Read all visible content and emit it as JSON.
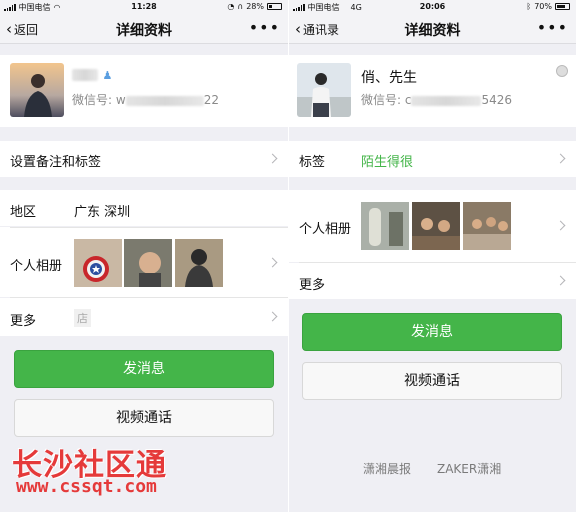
{
  "left": {
    "status": {
      "carrier": "中国电信",
      "time": "11:28",
      "battery": "28%",
      "battery_level": 0.28
    },
    "nav": {
      "back": "返回",
      "title": "详细资料",
      "more": "•••"
    },
    "profile": {
      "wechat_label": "微信号: w",
      "wechat_tail": "22"
    },
    "remark_row": "设置备注和标签",
    "region": {
      "label": "地区",
      "value": "广东  深圳"
    },
    "album": {
      "label": "个人相册"
    },
    "more": {
      "label": "更多",
      "value": "店"
    },
    "buttons": {
      "message": "发消息",
      "video": "视频通话"
    }
  },
  "right": {
    "status": {
      "carrier": "中国电信",
      "network": "4G",
      "time": "20:06",
      "battery": "70%",
      "battery_level": 0.7
    },
    "nav": {
      "back": "通讯录",
      "title": "详细资料",
      "more": "•••"
    },
    "profile": {
      "name": "俏、先生",
      "wechat_label": "微信号: c",
      "wechat_tail": "5426"
    },
    "tag": {
      "label": "标签",
      "value": "陌生得很"
    },
    "album": {
      "label": "个人相册"
    },
    "more": {
      "label": "更多"
    },
    "buttons": {
      "message": "发消息",
      "video": "视频通话"
    }
  },
  "watermarks": {
    "cn": "长沙社区通",
    "url": "www.cssqt.com",
    "brand1": "潇湘晨报",
    "brand2": "ZAKER潇湘"
  },
  "colors": {
    "green": "#44b549",
    "tag_green": "#44b549",
    "watermark_red": "#e53a3a"
  }
}
